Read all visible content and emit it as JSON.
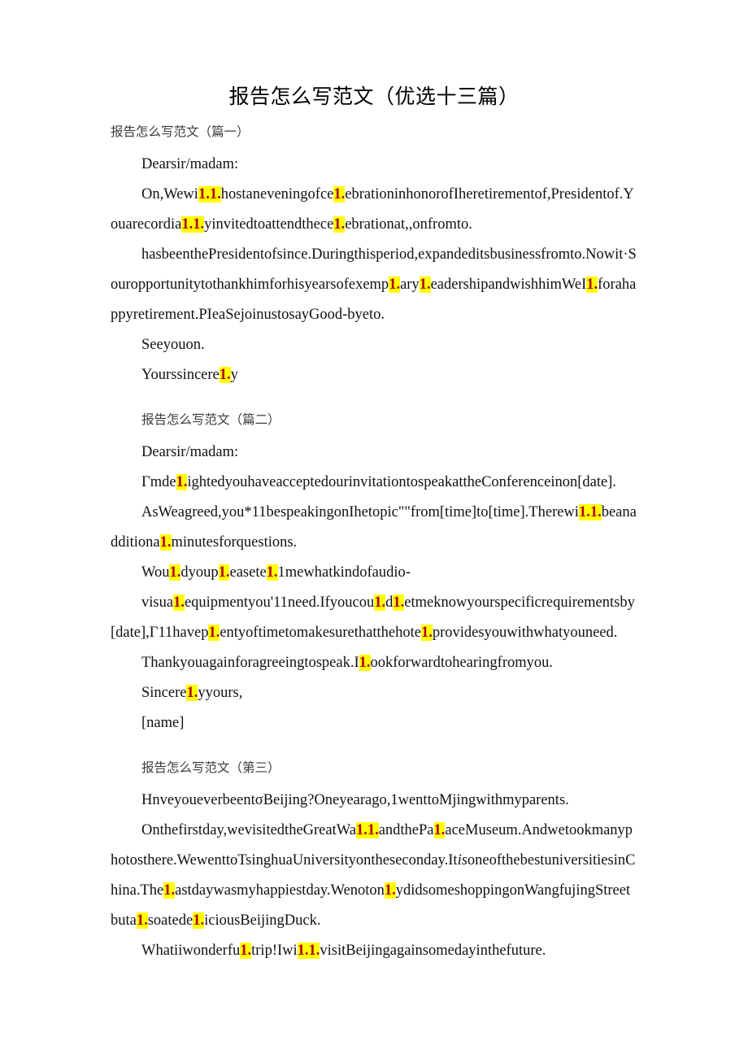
{
  "document": {
    "title": "报告怎么写范文（优选十三篇）",
    "highlight_color": "#ffff00",
    "highlight_text_color": "#b00000",
    "page_background": "#ffffff",
    "body_text_color": "#111111",
    "heading_text_color": "#3b3b3b"
  },
  "sections": [
    {
      "heading": "报告怎么写范文（篇一）",
      "paragraphs": [
        {
          "id": "p1",
          "runs": [
            {
              "text": "Dearsir/madam:",
              "highlight": false
            }
          ]
        },
        {
          "id": "p2",
          "runs": [
            {
              "text": "On,Wewi",
              "highlight": false
            },
            {
              "text": "1.1.",
              "highlight": true
            },
            {
              "text": "hostaneveningofce",
              "highlight": false
            },
            {
              "text": "1.",
              "highlight": true
            },
            {
              "text": "ebrationinhonorofIheretirementof,Presidentof.Youarecordia",
              "highlight": false
            },
            {
              "text": "1.1.",
              "highlight": true
            },
            {
              "text": "yinvitedtoattendthece",
              "highlight": false
            },
            {
              "text": "1.",
              "highlight": true
            },
            {
              "text": "ebrationat,,onfromto.",
              "highlight": false
            }
          ]
        },
        {
          "id": "p3",
          "runs": [
            {
              "text": "hasbeenthePresidentofsince.Duringthisperiod,expandeditsbusinessfromto.Nowit·Souropportunitytothankhimforhisyearsofexemp",
              "highlight": false
            },
            {
              "text": "1.",
              "highlight": true
            },
            {
              "text": "ary",
              "highlight": false
            },
            {
              "text": "1.",
              "highlight": true
            },
            {
              "text": "eadershipandwishhimWeI",
              "highlight": false
            },
            {
              "text": "1.",
              "highlight": true
            },
            {
              "text": "forahappyretirement.PIeaSejoinustosayGood-byeto.",
              "highlight": false
            }
          ]
        },
        {
          "id": "p4",
          "runs": [
            {
              "text": "Seeyouon.",
              "highlight": false
            }
          ]
        },
        {
          "id": "p5",
          "runs": [
            {
              "text": "Yourssincere",
              "highlight": false
            },
            {
              "text": "1.",
              "highlight": true
            },
            {
              "text": "y",
              "highlight": false
            }
          ]
        }
      ]
    },
    {
      "heading": "报告怎么写范文（篇二）",
      "paragraphs": [
        {
          "id": "p6",
          "runs": [
            {
              "text": "Dearsir/madam:",
              "highlight": false
            }
          ]
        },
        {
          "id": "p7",
          "runs": [
            {
              "text": "Γmde",
              "highlight": false
            },
            {
              "text": "1.",
              "highlight": true
            },
            {
              "text": "ightedyouhaveacceptedourinvitationtospeakattheConferenceinon[date].",
              "highlight": false
            }
          ]
        },
        {
          "id": "p8",
          "runs": [
            {
              "text": "AsWeagreed,you*11bespeakingonIhetopic\"\"from[time]to[time].Therewi",
              "highlight": false
            },
            {
              "text": "1.1.",
              "highlight": true
            },
            {
              "text": "beanadditiona",
              "highlight": false
            },
            {
              "text": "1.",
              "highlight": true
            },
            {
              "text": "minutesforquestions.",
              "highlight": false
            }
          ]
        },
        {
          "id": "p9",
          "runs": [
            {
              "text": "Wou",
              "highlight": false
            },
            {
              "text": "1.",
              "highlight": true
            },
            {
              "text": "dyoup",
              "highlight": false
            },
            {
              "text": "1.",
              "highlight": true
            },
            {
              "text": "easete",
              "highlight": false
            },
            {
              "text": "1.",
              "highlight": true
            },
            {
              "text": "1mewhatkindofaudio-",
              "highlight": false
            }
          ]
        },
        {
          "id": "p10",
          "runs": [
            {
              "text": "visua",
              "highlight": false
            },
            {
              "text": "1.",
              "highlight": true
            },
            {
              "text": "equipmentyou'11need.Ifyoucou",
              "highlight": false
            },
            {
              "text": "1.",
              "highlight": true
            },
            {
              "text": "d",
              "highlight": false
            },
            {
              "text": "1.",
              "highlight": true
            },
            {
              "text": "etmeknowyourspecificrequirementsby[date],Γ11havep",
              "highlight": false
            },
            {
              "text": "1.",
              "highlight": true
            },
            {
              "text": "entyoftimetomakesurethatthehote",
              "highlight": false
            },
            {
              "text": "1.",
              "highlight": true
            },
            {
              "text": "providesyouwithwhatyouneed.",
              "highlight": false
            }
          ]
        },
        {
          "id": "p11",
          "runs": [
            {
              "text": "Thankyouagainforagreeingtospeak.I",
              "highlight": false
            },
            {
              "text": "1.",
              "highlight": true
            },
            {
              "text": "ookforwardtohearingfromyou.",
              "highlight": false
            }
          ]
        },
        {
          "id": "p12",
          "runs": [
            {
              "text": "Sincere",
              "highlight": false
            },
            {
              "text": "1.",
              "highlight": true
            },
            {
              "text": "yyours,",
              "highlight": false
            }
          ]
        },
        {
          "id": "p13",
          "runs": [
            {
              "text": "[name]",
              "highlight": false
            }
          ]
        }
      ]
    },
    {
      "heading": "报告怎么写范文（第三）",
      "paragraphs": [
        {
          "id": "p14",
          "runs": [
            {
              "text": "HnveyoueverbeentσBeijing?Oneyearago,1wenttoMjingwithmyparents.",
              "highlight": false
            }
          ]
        },
        {
          "id": "p15",
          "runs": [
            {
              "text": "Onthefirstday,wevisitedtheGreatWa",
              "highlight": false
            },
            {
              "text": "1.1.",
              "highlight": true
            },
            {
              "text": "andthePa",
              "highlight": false
            },
            {
              "text": "1.",
              "highlight": true
            },
            {
              "text": "aceMuseum.Andwetookmanyphotosthere.WewenttoTsinghuaUniversityontheseconday.It",
              "highlight": false
            },
            {
              "text": "is",
              "highlight": false,
              "italic": true
            },
            {
              "text": "oneofthebestuniversitiesinChina.The",
              "highlight": false
            },
            {
              "text": "1.",
              "highlight": true
            },
            {
              "text": "astdaywasmyhappiestday.Wenoton",
              "highlight": false
            },
            {
              "text": "1.",
              "highlight": true
            },
            {
              "text": "ydidsomeshoppingonWangfujingStreetbuta",
              "highlight": false
            },
            {
              "text": "1.",
              "highlight": true
            },
            {
              "text": "soatede",
              "highlight": false
            },
            {
              "text": "1.",
              "highlight": true
            },
            {
              "text": "iciousBeijingDuck.",
              "highlight": false
            }
          ]
        },
        {
          "id": "p16",
          "runs": [
            {
              "text": "Whatiiwonderfu",
              "highlight": false
            },
            {
              "text": "1.",
              "highlight": true
            },
            {
              "text": "trip!Iwi",
              "highlight": false
            },
            {
              "text": "1.1.",
              "highlight": true
            },
            {
              "text": "visitBeijingagainsomedayinthefuture.",
              "highlight": false
            }
          ]
        }
      ]
    }
  ]
}
